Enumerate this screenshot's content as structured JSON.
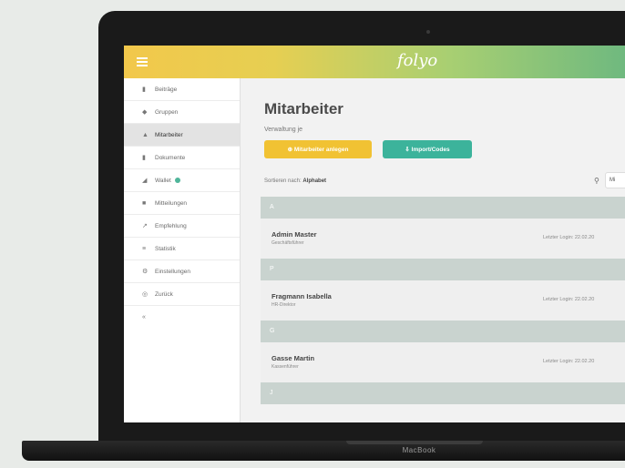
{
  "device": {
    "brand_label": "MacBook"
  },
  "app": {
    "logo_text": "folyo"
  },
  "sidebar": {
    "items": [
      {
        "icon": "document-icon",
        "glyph": "▮",
        "label": "Beiträge"
      },
      {
        "icon": "group-icon",
        "glyph": "◆",
        "label": "Gruppen"
      },
      {
        "icon": "user-icon",
        "glyph": "▲",
        "label": "Mitarbeiter",
        "active": true
      },
      {
        "icon": "file-icon",
        "glyph": "▮",
        "label": "Dokumente"
      },
      {
        "icon": "wallet-icon",
        "glyph": "◢",
        "label": "Wallet",
        "badge": true
      },
      {
        "icon": "megaphone-icon",
        "glyph": "■",
        "label": "Mitteilungen"
      },
      {
        "icon": "share-icon",
        "glyph": "↗",
        "label": "Empfehlung"
      },
      {
        "icon": "stats-icon",
        "glyph": "≡",
        "label": "Statistik"
      },
      {
        "icon": "settings-icon",
        "glyph": "⚙",
        "label": "Einstellungen"
      },
      {
        "icon": "back-icon",
        "glyph": "◎",
        "label": "Zurück"
      },
      {
        "icon": "chevron-icon",
        "glyph": "«",
        "label": ""
      }
    ]
  },
  "main": {
    "title": "Mitarbeiter",
    "subtitle": "Verwaltung je",
    "add_button": "⊕ Mitarbeiter anlegen",
    "import_button": "⇩ Import/Codes",
    "sort_prefix": "Sortieren nach:",
    "sort_value": "Alphabet",
    "search_value": "Mi"
  },
  "groups": [
    {
      "letter": "A",
      "employee": {
        "name": "Admin Master",
        "role": "Geschäftsführer",
        "login": "Letzter Login: 22.02.20"
      }
    },
    {
      "letter": "P",
      "employee": {
        "name": "Fragmann Isabella",
        "role": "HR-Direktor",
        "login": "Letzter Login: 22.02.20"
      }
    },
    {
      "letter": "G",
      "employee": {
        "name": "Gasse Martin",
        "role": "Kassenführer",
        "login": "Letzter Login: 22.02.20"
      }
    },
    {
      "letter": "J"
    }
  ],
  "colors": {
    "accent_yellow": "#f1c233",
    "accent_teal": "#3cb39b",
    "group_bar": "#c9d3cf"
  }
}
